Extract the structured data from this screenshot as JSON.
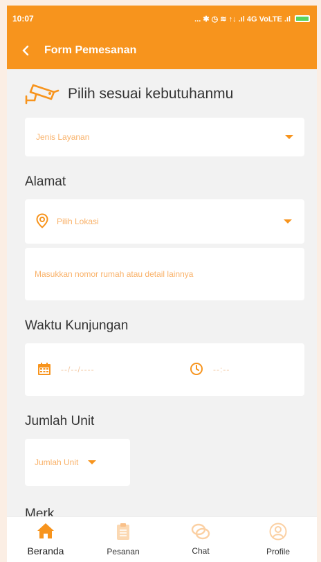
{
  "status_bar": {
    "time": "10:07",
    "indicators": "... ✱ ◷ ≋ ↑↓ .ıl 4G VoLTE .ıl"
  },
  "app_bar": {
    "title": "Form Pemesanan",
    "back_icon": "chevron-left-icon"
  },
  "service": {
    "heading": "Pilih sesuai kebutuhanmu",
    "icon": "cctv-camera-icon",
    "select_placeholder": "Jenis Layanan"
  },
  "address": {
    "label": "Alamat",
    "location_placeholder": "Pilih Lokasi",
    "detail_placeholder": "Masukkan nomor rumah atau detail lainnya"
  },
  "visit": {
    "label": "Waktu Kunjungan",
    "date_placeholder": "--/--/----",
    "time_placeholder": "--:--"
  },
  "units": {
    "label": "Jumlah Unit",
    "select_placeholder": "Jumlah Unit"
  },
  "brand": {
    "label": "Merk"
  },
  "bottom_nav": {
    "items": [
      {
        "label": "Beranda",
        "icon": "home-icon",
        "active": true
      },
      {
        "label": "Pesanan",
        "icon": "clipboard-icon",
        "active": false
      },
      {
        "label": "Chat",
        "icon": "chat-icon",
        "active": false
      },
      {
        "label": "Profile",
        "icon": "user-icon",
        "active": false
      }
    ]
  },
  "colors": {
    "primary": "#f7941d",
    "placeholder": "#f9b26a",
    "background": "#f2f2f2"
  }
}
